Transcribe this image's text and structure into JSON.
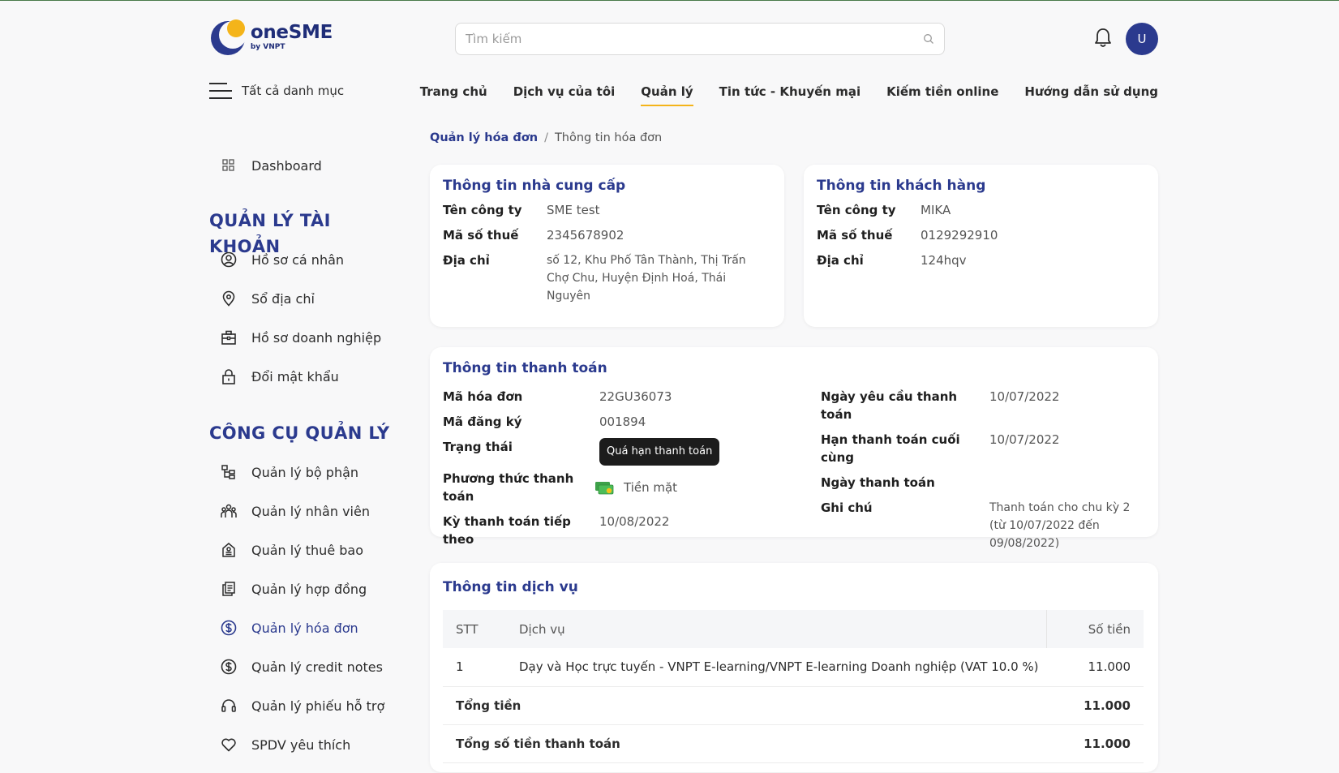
{
  "brand": {
    "name": "oneSME",
    "sub": "by VNPT"
  },
  "search": {
    "placeholder": "Tìm kiếm"
  },
  "user": {
    "initial": "U"
  },
  "all_categories": "Tất cả danh mục",
  "nav": [
    {
      "label": "Trang chủ"
    },
    {
      "label": "Dịch vụ của tôi"
    },
    {
      "label": "Quản lý",
      "active": true
    },
    {
      "label": "Tin tức - Khuyến mại"
    },
    {
      "label": "Kiếm tiền online"
    },
    {
      "label": "Hướng dẫn sử dụng"
    }
  ],
  "sidebar": {
    "dashboard": "Dashboard",
    "account_heading": "QUẢN LÝ TÀI KHOẢN",
    "account_items": [
      {
        "label": "Hồ sơ cá nhân",
        "icon": "user-circle-icon"
      },
      {
        "label": "Sổ địa chỉ",
        "icon": "location-pin-icon"
      },
      {
        "label": "Hồ sơ doanh nghiệp",
        "icon": "briefcase-icon"
      },
      {
        "label": "Đổi mật khẩu",
        "icon": "lock-icon"
      }
    ],
    "tools_heading": "CÔNG CỤ QUẢN LÝ",
    "tools_items": [
      {
        "label": "Quản lý bộ phận",
        "icon": "org-tree-icon"
      },
      {
        "label": "Quản lý nhân viên",
        "icon": "people-icon"
      },
      {
        "label": "Quản lý thuê bao",
        "icon": "subscription-icon"
      },
      {
        "label": "Quản lý hợp đồng",
        "icon": "document-icon"
      },
      {
        "label": "Quản lý hóa đơn",
        "icon": "dollar-circle-icon",
        "active": true
      },
      {
        "label": "Quản lý credit notes",
        "icon": "dollar-circle-icon"
      },
      {
        "label": "Quản lý phiếu hỗ trợ",
        "icon": "headset-icon"
      },
      {
        "label": "SPDV yêu thích",
        "icon": "heart-icon"
      }
    ]
  },
  "breadcrumb": {
    "parent": "Quản lý hóa đơn",
    "separator": "/",
    "current": "Thông tin hóa đơn"
  },
  "supplier": {
    "title": "Thông tin nhà cung cấp",
    "company_label": "Tên công ty",
    "company": "SME test",
    "tax_label": "Mã số thuế",
    "tax": "2345678902",
    "address_label": "Địa chỉ",
    "address": "số 12, Khu Phố Tân Thành, Thị Trấn Chợ Chu, Huyện Định Hoá, Thái Nguyên"
  },
  "customer": {
    "title": "Thông tin khách hàng",
    "company_label": "Tên công ty",
    "company": "MIKA",
    "tax_label": "Mã số thuế",
    "tax": "0129292910",
    "address_label": "Địa chỉ",
    "address": "124hqv"
  },
  "payment": {
    "title": "Thông tin thanh toán",
    "invoice_code_label": "Mã hóa đơn",
    "invoice_code": "22GU36073",
    "reg_code_label": "Mã đăng ký",
    "reg_code": "001894",
    "status_label": "Trạng thái",
    "status": "Quá hạn thanh toán",
    "method_label": "Phương thức thanh toán",
    "method": "Tiền mặt",
    "next_period_label": "Kỳ thanh toán tiếp theo",
    "next_period": "10/08/2022",
    "request_date_label": "Ngày yêu cầu thanh toán",
    "request_date": "10/07/2022",
    "deadline_label": "Hạn thanh toán cuối cùng",
    "deadline": "10/07/2022",
    "paid_date_label": "Ngày thanh toán",
    "paid_date": "",
    "note_label": "Ghi chú",
    "note": "Thanh toán cho chu kỳ 2 (từ 10/07/2022 đến 09/08/2022)"
  },
  "service": {
    "title": "Thông tin dịch vụ",
    "columns": {
      "stt": "STT",
      "service": "Dịch vụ",
      "amount": "Số tiền"
    },
    "rows": [
      {
        "stt": "1",
        "service": "Dạy và Học trực tuyến - VNPT E-learning/VNPT E-learning Doanh nghiệp (VAT 10.0 %)",
        "amount": "11.000"
      }
    ],
    "total_label": "Tổng tiền",
    "total": "11.000",
    "grand_total_label": "Tổng số tiền thanh toán",
    "grand_total": "11.000"
  },
  "colors": {
    "brand": "#2b3a8e",
    "accent": "#f4b41a",
    "badge": "#1c1c1c"
  }
}
